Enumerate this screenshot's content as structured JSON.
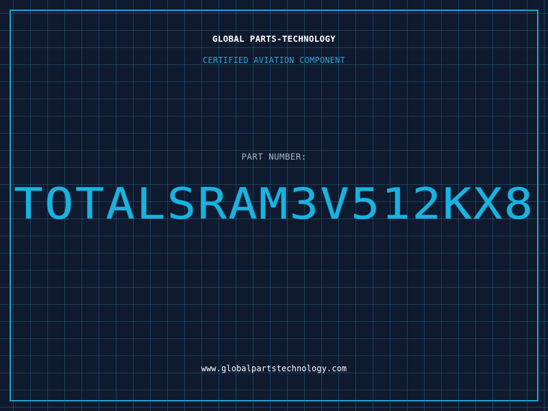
{
  "header": {
    "company": "GLOBAL PARTS-TECHNOLOGY",
    "subtitle": "CERTIFIED AVIATION COMPONENT"
  },
  "part": {
    "label": "PART NUMBER:",
    "number": "TOTALSRAM3V512KX8"
  },
  "footer": {
    "website": "www.globalpartstechnology.com"
  },
  "colors": {
    "background": "#0f1a2e",
    "grid": "#286e96",
    "frame": "#1fa3cf",
    "accent": "#19b3e0",
    "label": "#a9b7c6",
    "text": "#ffffff"
  }
}
